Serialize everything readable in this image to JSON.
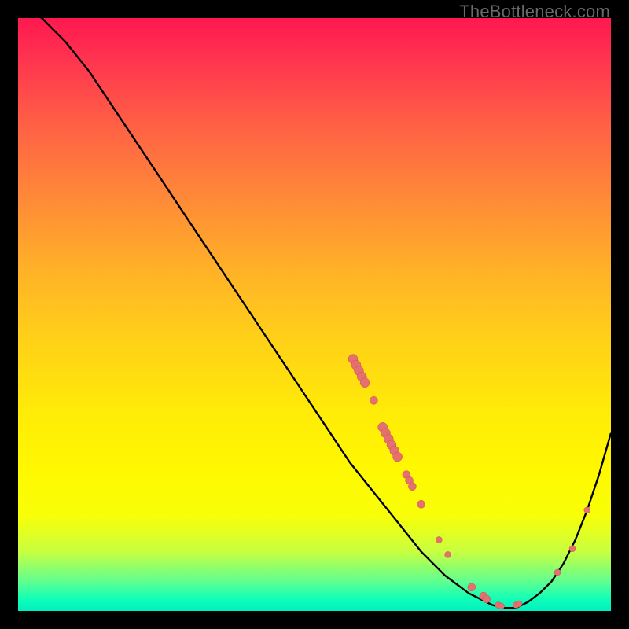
{
  "watermark_text": "TheBottleneck.com",
  "chart_data": {
    "type": "line",
    "title": "",
    "xlabel": "",
    "ylabel": "",
    "xlim": [
      0,
      100
    ],
    "ylim": [
      0,
      100
    ],
    "series": [
      {
        "name": "bottleneck-curve",
        "x": [
          0,
          4,
          8,
          12,
          16,
          20,
          24,
          28,
          32,
          36,
          40,
          44,
          48,
          52,
          56,
          60,
          64,
          68,
          72,
          76,
          80,
          82,
          84,
          86,
          88,
          90,
          92,
          94,
          96,
          98,
          100
        ],
        "y": [
          103,
          100,
          96,
          91,
          85,
          79,
          73,
          67,
          61,
          55,
          49,
          43,
          37,
          31,
          25,
          20,
          15,
          10,
          6,
          3,
          1,
          0.5,
          0.5,
          1.5,
          3,
          5,
          8,
          12,
          17,
          23,
          30
        ]
      }
    ],
    "sample_points": [
      {
        "x": 56.5,
        "y": 42.5,
        "r": 6
      },
      {
        "x": 57.0,
        "y": 41.5,
        "r": 6
      },
      {
        "x": 57.5,
        "y": 40.5,
        "r": 6
      },
      {
        "x": 58.0,
        "y": 39.5,
        "r": 6
      },
      {
        "x": 58.5,
        "y": 38.5,
        "r": 6
      },
      {
        "x": 60.0,
        "y": 35.5,
        "r": 5
      },
      {
        "x": 61.5,
        "y": 31.0,
        "r": 6
      },
      {
        "x": 62.0,
        "y": 30.0,
        "r": 6
      },
      {
        "x": 62.5,
        "y": 29.0,
        "r": 6
      },
      {
        "x": 63.0,
        "y": 28.0,
        "r": 6
      },
      {
        "x": 63.5,
        "y": 27.0,
        "r": 6
      },
      {
        "x": 64.0,
        "y": 26.0,
        "r": 6
      },
      {
        "x": 65.5,
        "y": 23.0,
        "r": 5
      },
      {
        "x": 66.0,
        "y": 22.0,
        "r": 5
      },
      {
        "x": 66.5,
        "y": 21.0,
        "r": 5
      },
      {
        "x": 68.0,
        "y": 18.0,
        "r": 5
      },
      {
        "x": 71.0,
        "y": 12.0,
        "r": 4
      },
      {
        "x": 72.5,
        "y": 9.5,
        "r": 4
      },
      {
        "x": 76.5,
        "y": 4.0,
        "r": 5
      },
      {
        "x": 78.5,
        "y": 2.5,
        "r": 5
      },
      {
        "x": 79.0,
        "y": 2.0,
        "r": 5
      },
      {
        "x": 81.0,
        "y": 1.0,
        "r": 4
      },
      {
        "x": 81.5,
        "y": 0.8,
        "r": 4
      },
      {
        "x": 84.0,
        "y": 1.0,
        "r": 4
      },
      {
        "x": 84.5,
        "y": 1.2,
        "r": 4
      },
      {
        "x": 91.0,
        "y": 6.5,
        "r": 4
      },
      {
        "x": 93.5,
        "y": 10.5,
        "r": 4
      },
      {
        "x": 96.0,
        "y": 17.0,
        "r": 4
      }
    ],
    "colors": {
      "curve": "#000000",
      "points_fill": "#e47070",
      "points_stroke": "#c85050"
    }
  }
}
